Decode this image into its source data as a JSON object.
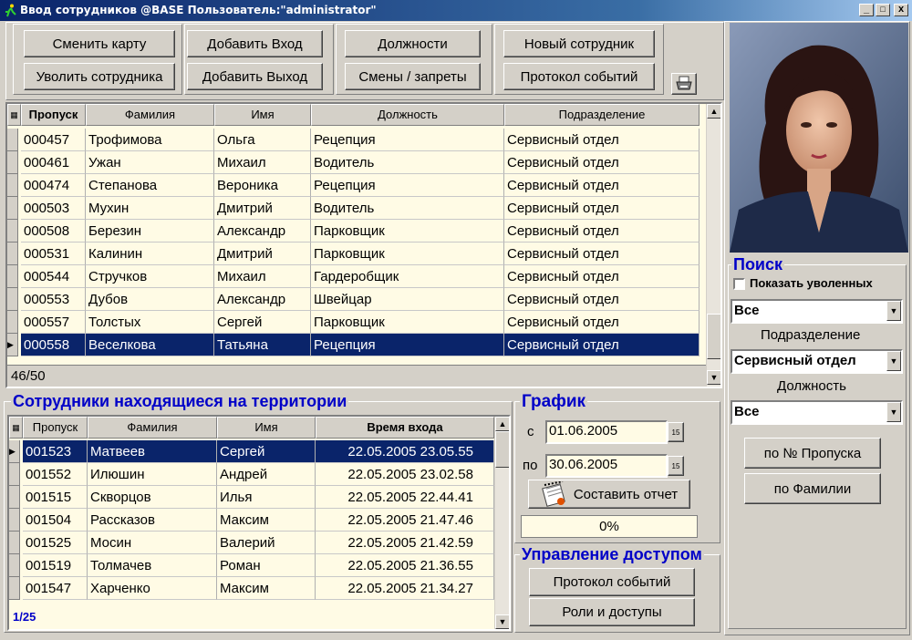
{
  "window": {
    "title": "Ввод сотрудников  @BASE Пользователь:\"administrator\"",
    "min": "_",
    "max": "□",
    "close": "x"
  },
  "toolbar": {
    "change_card": "Сменить карту",
    "fire_employee": "Уволить сотрудника",
    "add_entry": "Добавить Вход",
    "add_exit": "Добавить Выход",
    "positions": "Должности",
    "shifts": "Смены / запреты",
    "new_employee": "Новый сотрудник",
    "event_log": "Протокол событий"
  },
  "employees": {
    "columns": [
      "Пропуск",
      "Фамилия",
      "Имя",
      "Должность",
      "Подразделение"
    ],
    "rows": [
      [
        "000457",
        "Трофимова",
        "Ольга",
        "Рецепция",
        "Сервисный отдел"
      ],
      [
        "000461",
        "Ужан",
        "Михаил",
        "Водитель",
        "Сервисный отдел"
      ],
      [
        "000474",
        "Степанова",
        "Вероника",
        "Рецепция",
        "Сервисный отдел"
      ],
      [
        "000503",
        "Мухин",
        "Дмитрий",
        "Водитель",
        "Сервисный отдел"
      ],
      [
        "000508",
        "Березин",
        "Александр",
        "Парковщик",
        "Сервисный отдел"
      ],
      [
        "000531",
        "Калинин",
        "Дмитрий",
        "Парковщик",
        "Сервисный отдел"
      ],
      [
        "000544",
        "Стручков",
        "Михаил",
        "Гардеробщик",
        "Сервисный отдел"
      ],
      [
        "000553",
        "Дубов",
        "Александр",
        "Швейцар",
        "Сервисный отдел"
      ],
      [
        "000557",
        "Толстых",
        "Сергей",
        "Парковщик",
        "Сервисный отдел"
      ],
      [
        "000558",
        "Веселкова",
        "Татьяна",
        "Рецепция",
        "Сервисный отдел"
      ]
    ],
    "selected_index": 9,
    "counter": "46/50"
  },
  "on_site": {
    "title": "Сотрудники находящиеся на территории",
    "columns": [
      "Пропуск",
      "Фамилия",
      "Имя",
      "Время входа"
    ],
    "rows": [
      [
        "001523",
        "Матвеев",
        "Сергей",
        "22.05.2005 23.05.55"
      ],
      [
        "001552",
        "Илюшин",
        "Андрей",
        "22.05.2005 23.02.58"
      ],
      [
        "001515",
        "Скворцов",
        "Илья",
        "22.05.2005 22.44.41"
      ],
      [
        "001504",
        "Рассказов",
        "Максим",
        "22.05.2005 21.47.46"
      ],
      [
        "001525",
        "Мосин",
        "Валерий",
        "22.05.2005 21.42.59"
      ],
      [
        "001519",
        "Толмачев",
        "Роман",
        "22.05.2005 21.36.55"
      ],
      [
        "001547",
        "Харченко",
        "Максим",
        "22.05.2005 21.34.27"
      ]
    ],
    "selected_index": 0,
    "counter": "1/25"
  },
  "schedule": {
    "title": "График",
    "from_label": "с",
    "from_value": "01.06.2005",
    "to_label": "по",
    "to_value": "30.06.2005",
    "report_button": "Составить отчет",
    "progress_text": "0%",
    "progress": 0
  },
  "access": {
    "title": "Управление доступом",
    "event_log": "Протокол событий",
    "roles": "Роли и доступы"
  },
  "search": {
    "title": "Поиск",
    "show_fired": "Показать уволенных",
    "filter_all": "Все",
    "department_label": "Подразделение",
    "department_value": "Сервисный отдел",
    "position_label": "Должность",
    "position_value": "Все",
    "by_pass": "по № Пропуска",
    "by_surname": "по Фамилии"
  },
  "colors": {
    "selection": "#0a246a",
    "grid_bg": "#fffbe5",
    "group_title": "#0000c8"
  }
}
